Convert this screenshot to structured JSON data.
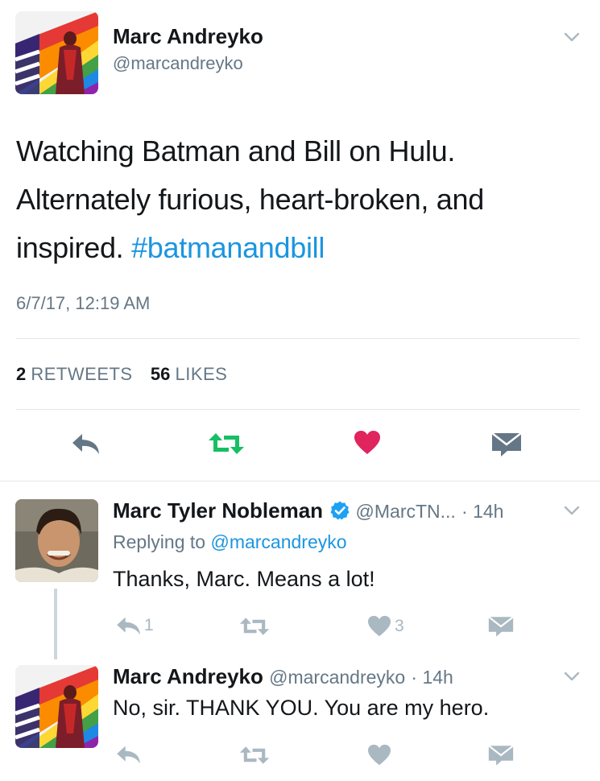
{
  "main_tweet": {
    "author_name": "Marc Andreyko",
    "author_handle": "@marcandreyko",
    "text_before": "Watching Batman and Bill on Hulu. Alternately furious, heart-broken, and inspired. ",
    "hashtag": "#batmanandbill",
    "timestamp": "6/7/17, 12:19 AM",
    "retweets_count": "2",
    "retweets_label": "RETWEETS",
    "likes_count": "56",
    "likes_label": "LIKES"
  },
  "reply1": {
    "author_name": "Marc Tyler Nobleman",
    "author_handle": "@MarcTN...",
    "time": "· 14h",
    "replying_prefix": "Replying to",
    "replying_to": "@marcandreyko",
    "text": "Thanks, Marc. Means a lot!",
    "reply_count": "1",
    "like_count": "3"
  },
  "reply2": {
    "author_name": "Marc Andreyko",
    "author_handle": "@marcandreyko",
    "time": "· 14h",
    "text": "No, sir. THANK YOU. You are my hero."
  },
  "colors": {
    "accent": "#1b95e0",
    "retweet_green": "#17bf63",
    "like_red": "#e0245e",
    "icon_dark": "#657786",
    "icon_light": "#aab8c2"
  },
  "icons": [
    "chevron-down-icon",
    "reply-icon",
    "retweet-icon",
    "heart-icon",
    "direct-message-icon",
    "verified-badge-icon"
  ]
}
